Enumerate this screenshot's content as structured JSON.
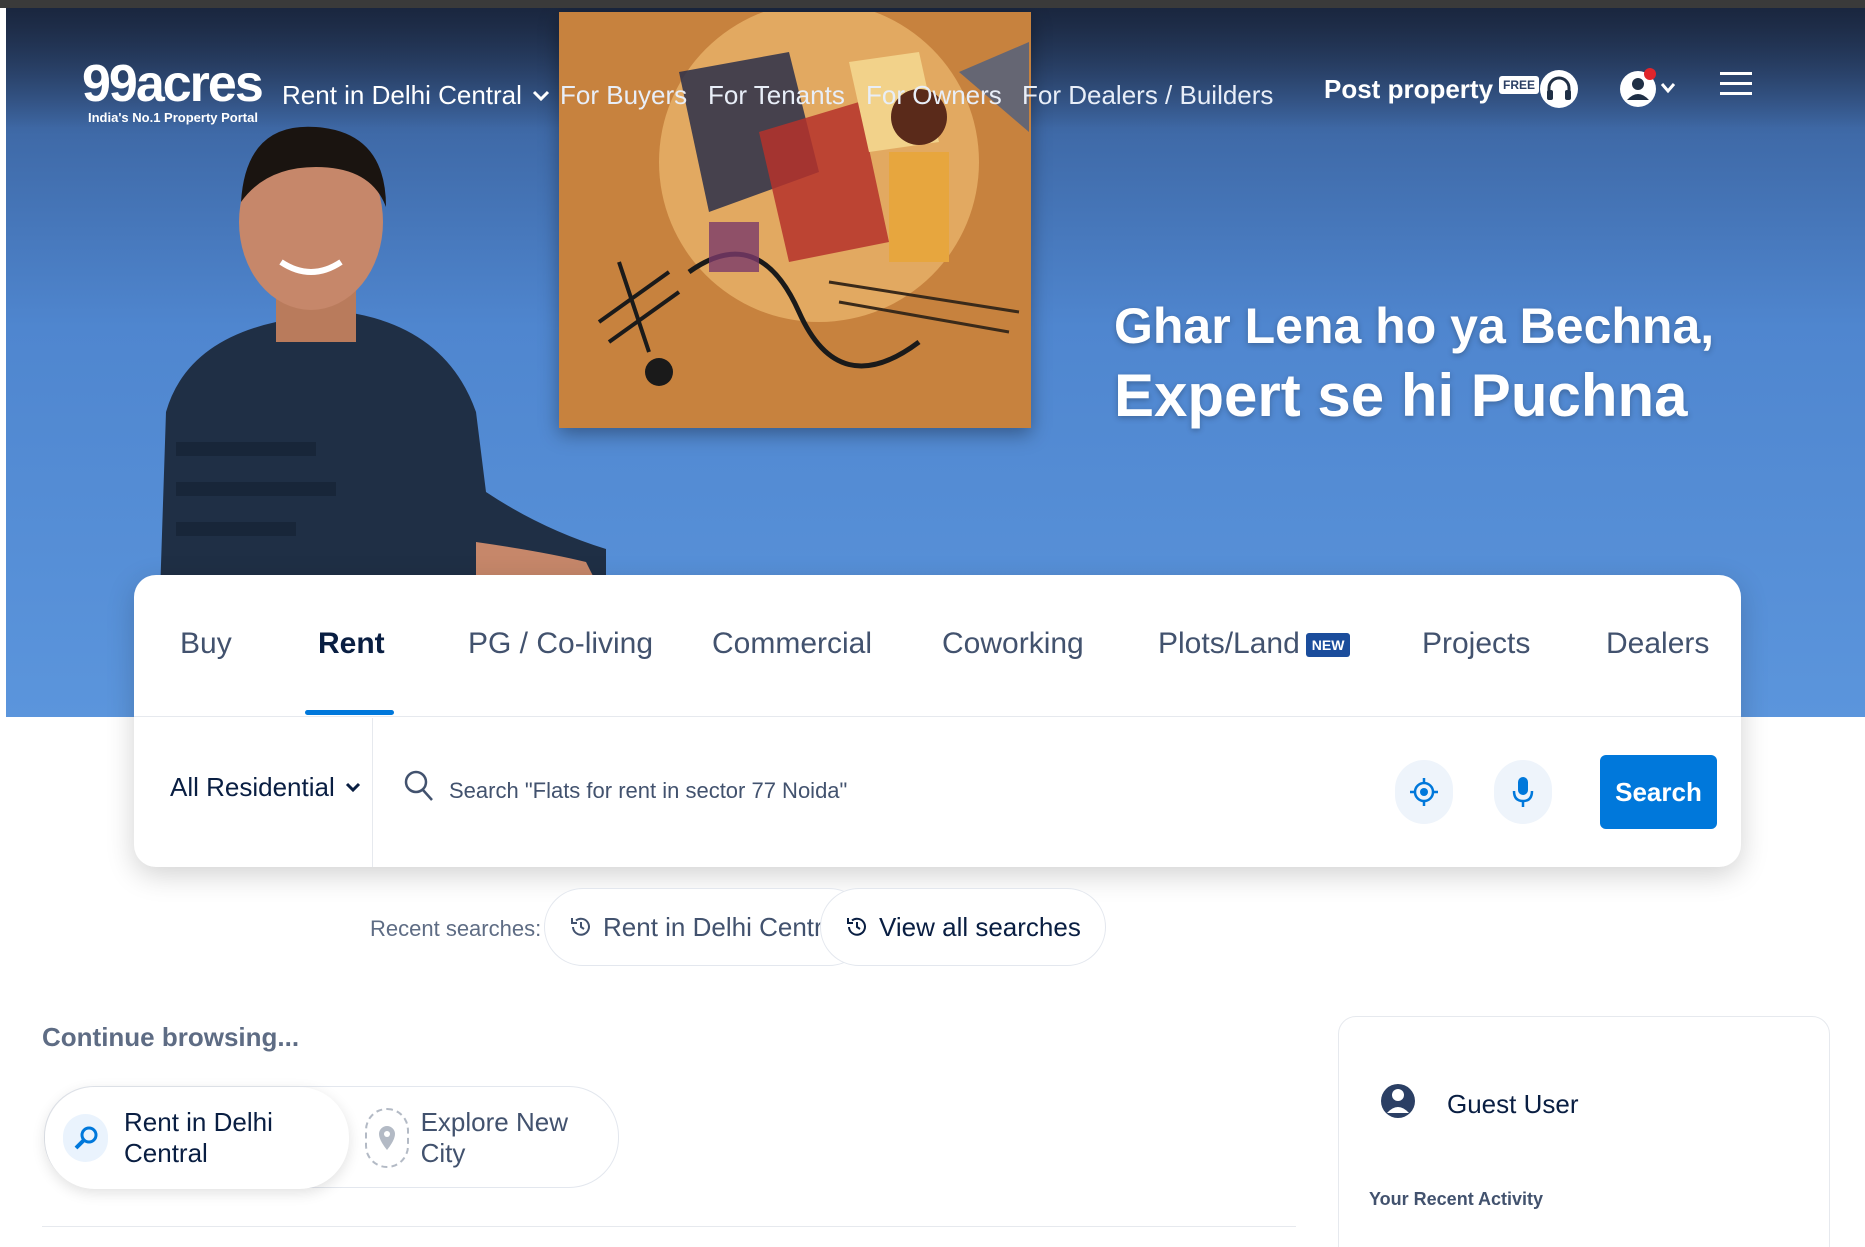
{
  "header": {
    "logo_main": "99acres",
    "logo_tagline": "India's No.1 Property Portal",
    "city_selector": "Rent in Delhi Central",
    "nav_links": [
      "For Buyers",
      "For Tenants",
      "For Owners",
      "For Dealers / Builders"
    ],
    "post_property": "Post property",
    "free_badge": "FREE"
  },
  "hero": {
    "headline_line1": "Ghar Lena ho ya Bechna,",
    "headline_line2": "Expert se hi Puchna"
  },
  "search_card": {
    "tabs": [
      {
        "label": "Buy",
        "active": false
      },
      {
        "label": "Rent",
        "active": true
      },
      {
        "label": "PG / Co-living",
        "active": false
      },
      {
        "label": "Commercial",
        "active": false
      },
      {
        "label": "Coworking",
        "active": false
      },
      {
        "label": "Plots/Land",
        "active": false
      },
      {
        "label": "Projects",
        "active": false
      },
      {
        "label": "Dealers",
        "active": false
      }
    ],
    "new_badge": "NEW",
    "property_type": "All Residential",
    "search_placeholder": "Search \"Flats for rent in sector 77 Noida\"",
    "search_button": "Search"
  },
  "recent_searches": {
    "label": "Recent searches:",
    "items": [
      "Rent in Delhi Central"
    ],
    "view_all": "View all searches"
  },
  "continue_browsing": {
    "title": "Continue browsing...",
    "active_item": "Rent in Delhi Central",
    "explore": "Explore New City"
  },
  "guest_panel": {
    "name": "Guest User",
    "recent_activity": "Your Recent Activity"
  },
  "colors": {
    "primary": "#0078db",
    "badge_new": "#1b4d9c",
    "text_dark": "#091e42",
    "text_muted": "#5e6c84"
  },
  "icons": [
    "chevron-down-icon",
    "headset-icon",
    "user-notification-icon",
    "hamburger-menu-icon",
    "search-icon",
    "locate-icon",
    "microphone-icon",
    "history-icon",
    "magnifier-key-icon",
    "location-pin-icon",
    "user-avatar-icon"
  ]
}
